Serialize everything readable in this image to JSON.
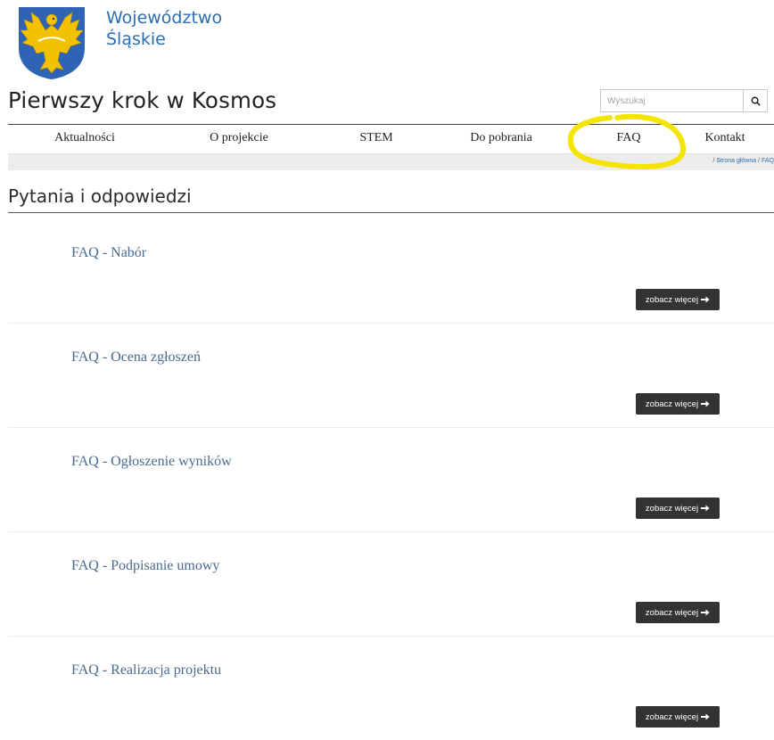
{
  "brand": {
    "line1": "Województwo",
    "line2": "Śląskie"
  },
  "site_title": "Pierwszy krok w Kosmos",
  "search": {
    "placeholder": "Wyszukaj"
  },
  "nav": [
    "Aktualności",
    "O projekcie",
    "STEM",
    "Do pobrania",
    "FAQ",
    "Kontakt"
  ],
  "breadcrumb": {
    "home": "Strona główna",
    "current": "FAQ"
  },
  "page_heading": "Pytania i odpowiedzi",
  "faq": [
    {
      "title": "FAQ - Nabór",
      "button": "zobacz więcej"
    },
    {
      "title": "FAQ - Ocena zgłoszeń",
      "button": "zobacz więcej"
    },
    {
      "title": "FAQ - Ogłoszenie wyników",
      "button": "zobacz więcej"
    },
    {
      "title": "FAQ - Podpisanie umowy",
      "button": "zobacz więcej"
    },
    {
      "title": "FAQ - Realizacja projektu",
      "button": "zobacz więcej"
    }
  ],
  "icons": {
    "logo": "silesian-eagle-coat-of-arms",
    "search": "search-icon",
    "arrow": "arrow-right-icon"
  },
  "colors": {
    "brand": "#2a6db0",
    "faq_title": "#4a6a8f",
    "button": "#333333",
    "highlight": "#f5e400",
    "shield": "#2e63b6",
    "eagle": "#f2c200"
  }
}
